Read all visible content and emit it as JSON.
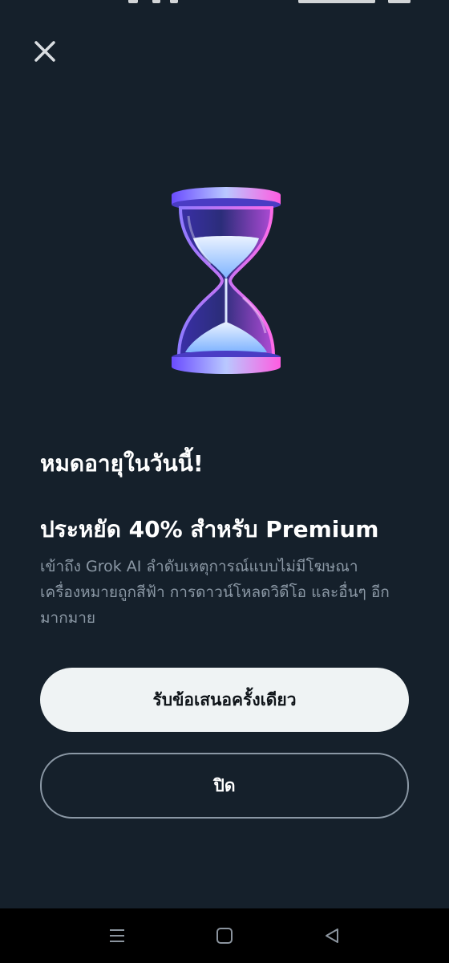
{
  "dialog": {
    "close_icon": "close-icon",
    "illustration": "hourglass-icon",
    "headline": "หมดอายุในวันนี้!",
    "offer_title": "ประหยัด 40% สำหรับ Premium",
    "description": "เข้าถึง Grok AI ลำดับเหตุการณ์แบบไม่มีโฆษณา เครื่องหมายถูกสีฟ้า การดาวน์โหลดวิดีโอ และอื่นๆ อีกมากมาย",
    "primary_button": "รับข้อเสนอครั้งเดียว",
    "secondary_button": "ปิด"
  },
  "navigation": {
    "icons": [
      "menu-icon",
      "home-icon",
      "back-icon"
    ]
  },
  "colors": {
    "background": "#15202b",
    "primary_button_bg": "#eff3f4",
    "muted_text": "#8b98a5",
    "nav_bar": "#000000"
  }
}
